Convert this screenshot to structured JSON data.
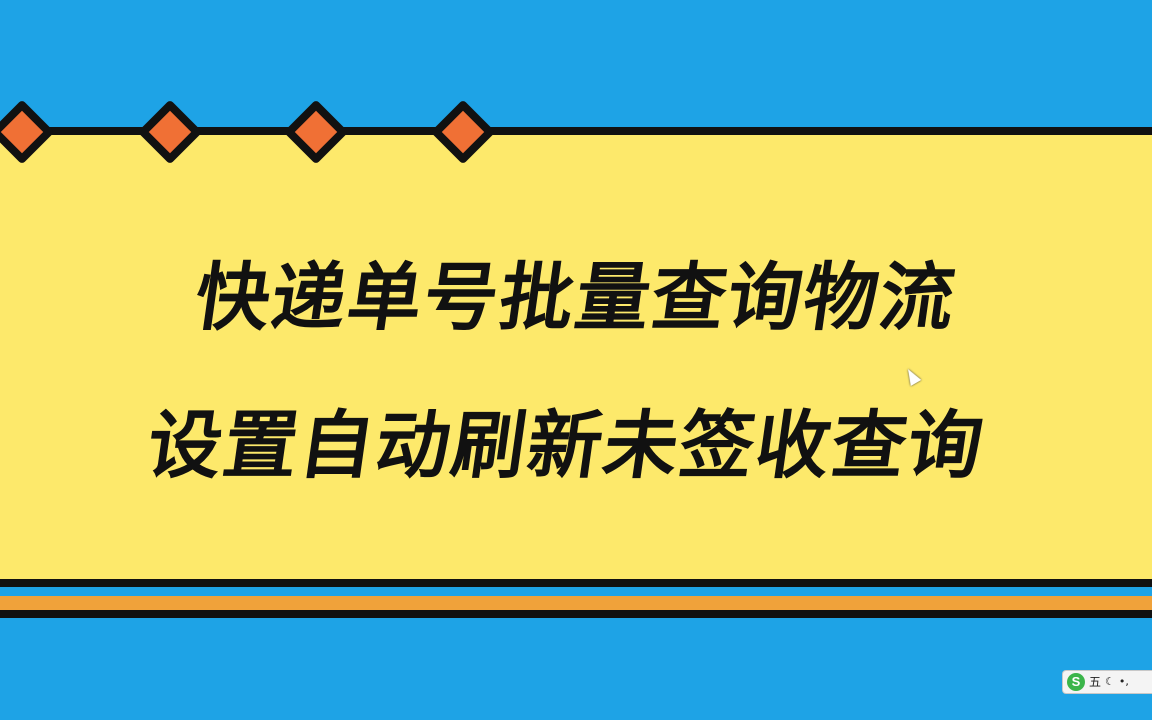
{
  "banner": {
    "title_line1": "快递单号批量查询物流",
    "title_line2": "设置自动刷新未签收查询"
  },
  "ime_toolbar": {
    "logo": "S",
    "mode": "五",
    "moon_icon": "☾",
    "punct_icon": "•,"
  },
  "colors": {
    "background": "#1ea3e6",
    "card": "#fde96b",
    "diamond": "#f07035",
    "outline": "#111111",
    "stripe": "#f0a23a"
  }
}
